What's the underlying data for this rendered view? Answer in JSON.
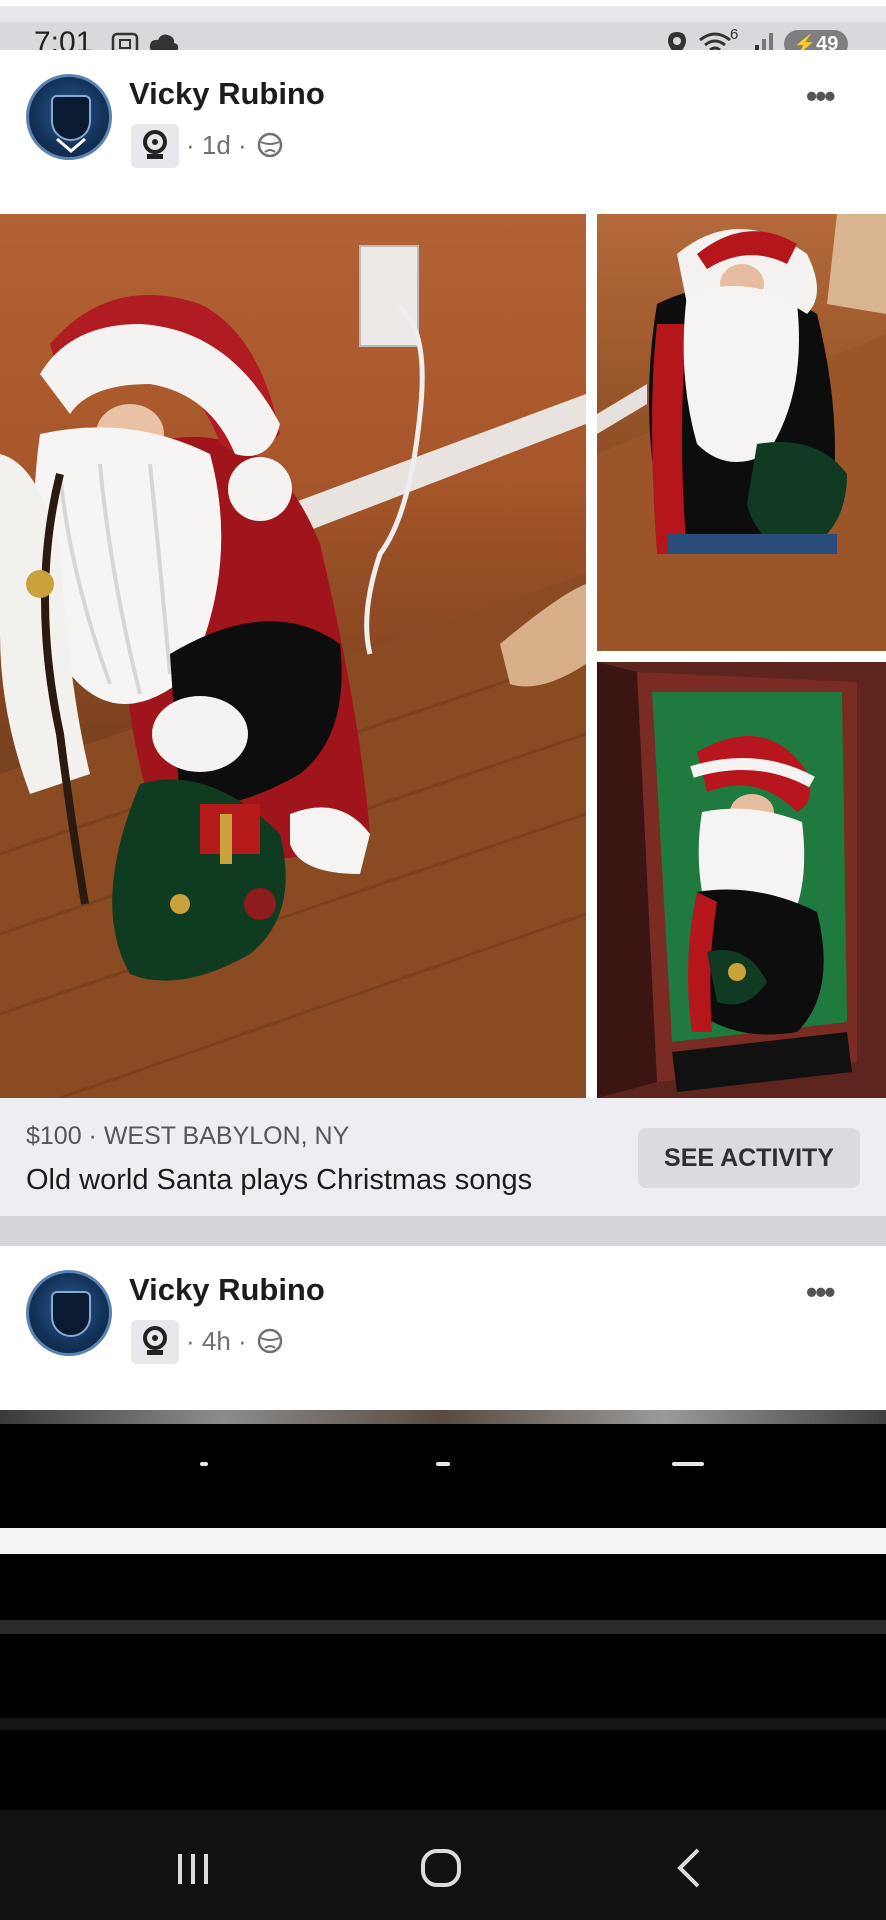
{
  "status_bar": {
    "time": "7:01",
    "battery": "49",
    "wifi_badge": "6",
    "icons": [
      "screenshot-icon",
      "cloud-icon",
      "location-icon",
      "wifi-icon",
      "signal-icon",
      "battery-charging-icon"
    ]
  },
  "post1": {
    "author": "Vicky Rubino",
    "time": "· 1d ·",
    "audience_icon": "globe-icon",
    "more": "•••"
  },
  "listing": {
    "price_location": "$100 · WEST BABYLON, NY",
    "title": "Old world Santa plays Christmas songs",
    "button": "SEE ACTIVITY"
  },
  "post2": {
    "author": "Vicky Rubino",
    "time": "· 4h ·",
    "audience_icon": "globe-icon",
    "more": "•••"
  },
  "nav": {
    "buttons": [
      "recent-apps-button",
      "home-button",
      "back-button"
    ]
  },
  "colors": {
    "status_bar_bg": "#d9d9dd",
    "card_bg": "#ffffff",
    "listing_bg": "#eeeef2",
    "button_bg": "#d9dbe0",
    "nav_bg": "#111111"
  }
}
